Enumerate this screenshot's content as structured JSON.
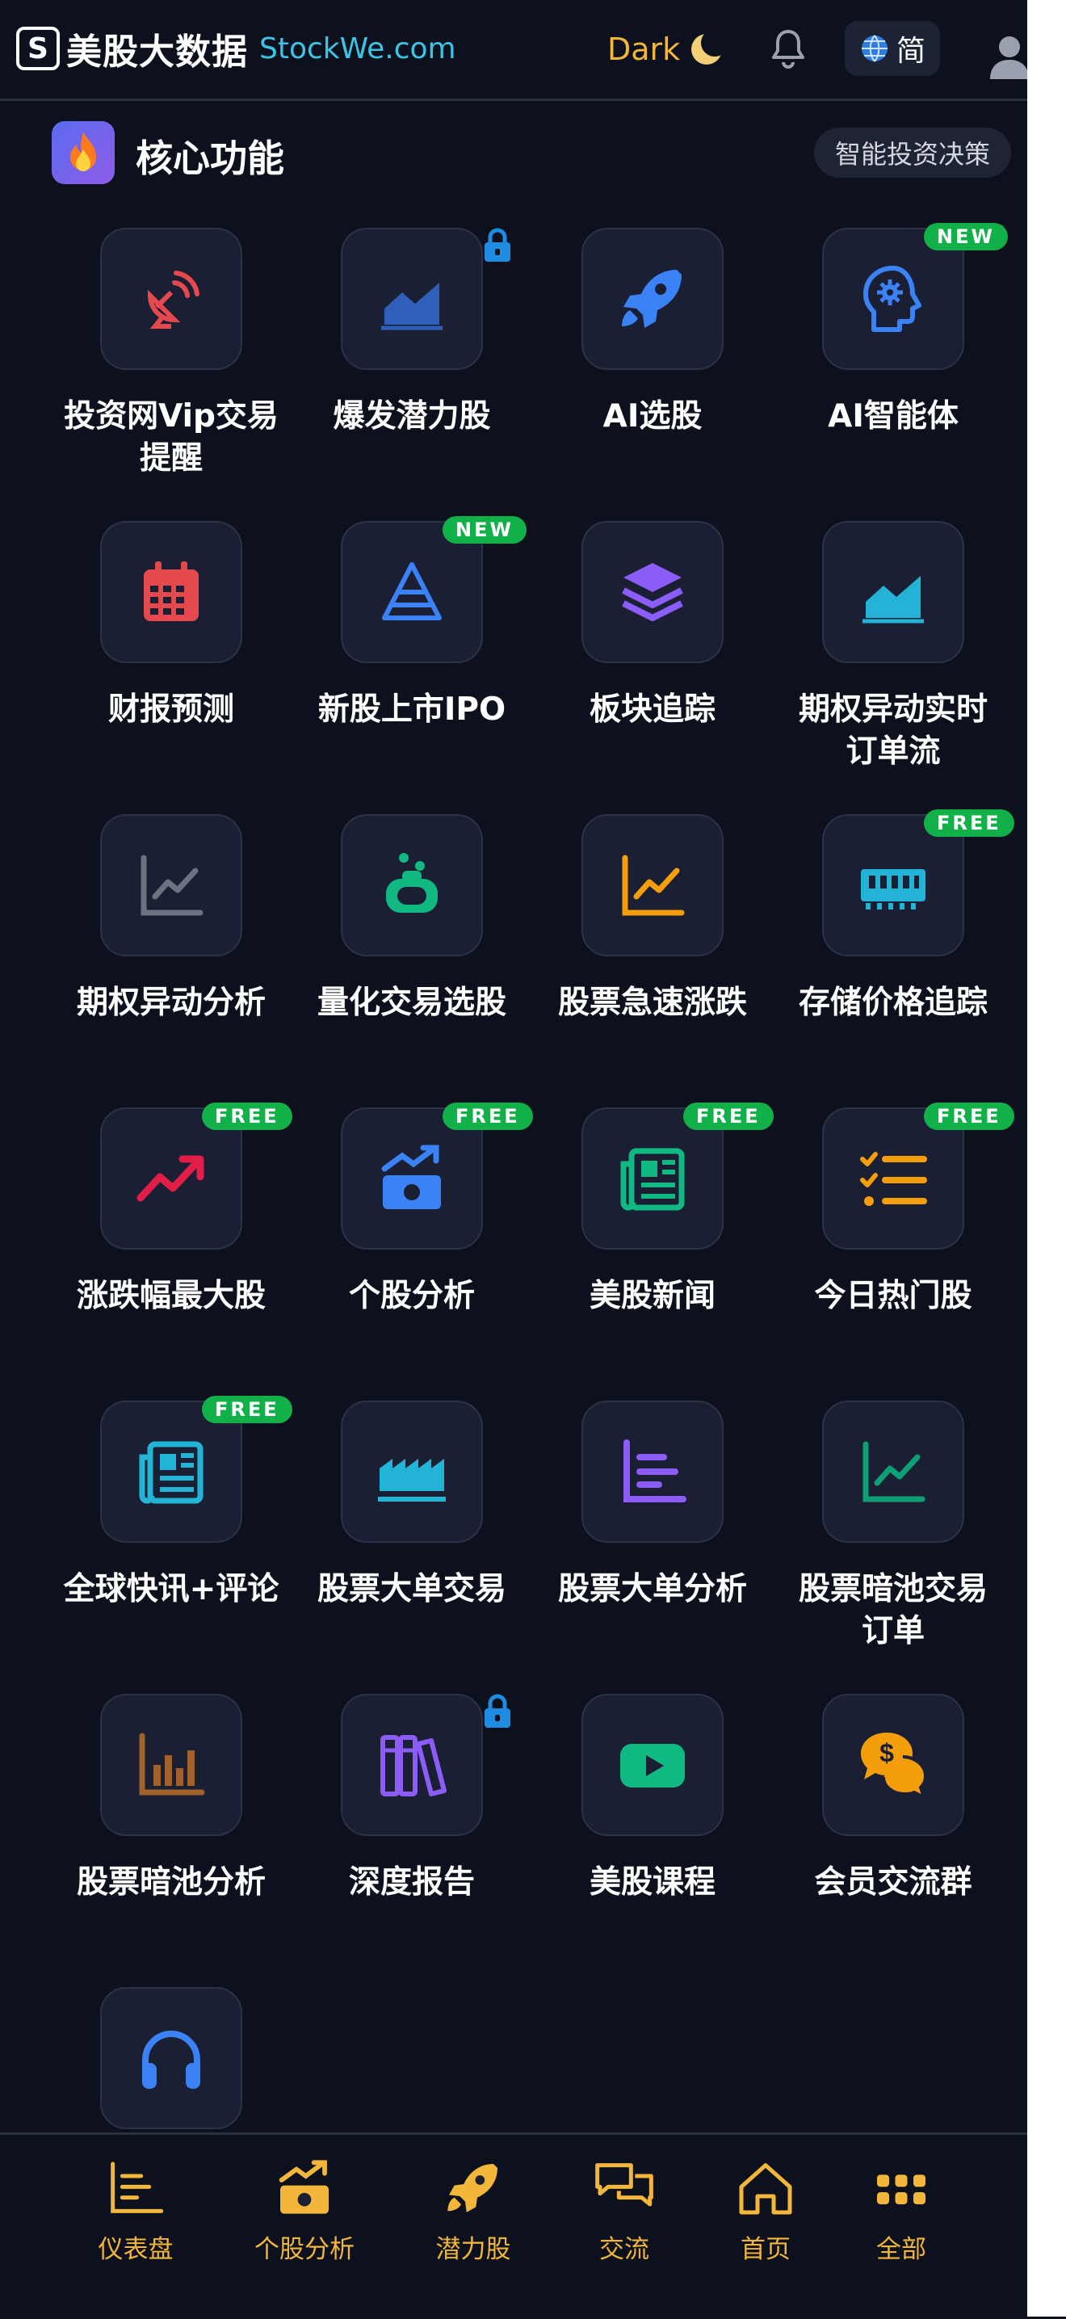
{
  "header": {
    "logo_cn": "美股大数据",
    "logo_en": "StockWe.com",
    "theme_label": "Dark",
    "language_label": "简"
  },
  "section": {
    "title": "核心功能",
    "pill": "智能投资决策"
  },
  "features": [
    {
      "label": "投资网Vip交易\n提醒",
      "icon": "satellite-dish-icon",
      "color": "#e5484d"
    },
    {
      "label": "爆发潜力股",
      "icon": "area-chart-icon",
      "color": "#2f5fb8",
      "locked": true
    },
    {
      "label": "AI选股",
      "icon": "rocket-icon",
      "color": "#3b82f6"
    },
    {
      "label": "AI智能体",
      "icon": "brain-gear-icon",
      "color": "#3b82f6",
      "badge": "NEW"
    },
    {
      "label": "财报预测",
      "icon": "calendar-icon",
      "color": "#e5484d"
    },
    {
      "label": "新股上市IPO",
      "icon": "pyramid-icon",
      "color": "#3b82f6",
      "badge": "NEW"
    },
    {
      "label": "板块追踪",
      "icon": "layers-icon",
      "color": "#8b5cf6"
    },
    {
      "label": "期权异动实时\n订单流",
      "icon": "area-chart-icon",
      "color": "#22b3d6"
    },
    {
      "label": "期权异动分析",
      "icon": "line-chart-icon",
      "color": "#6b7280"
    },
    {
      "label": "量化交易选股",
      "icon": "robot-icon",
      "color": "#10b981"
    },
    {
      "label": "股票急速涨跌",
      "icon": "line-chart-icon",
      "color": "#f59e0b"
    },
    {
      "label": "存储价格追踪",
      "icon": "memory-icon",
      "color": "#22b3d6",
      "badge": "FREE"
    },
    {
      "label": "涨跌幅最大股",
      "icon": "trend-up-icon",
      "color": "#e11d48",
      "badge": "FREE"
    },
    {
      "label": "个股分析",
      "icon": "money-trend-icon",
      "color": "#3b82f6",
      "badge": "FREE"
    },
    {
      "label": "美股新闻",
      "icon": "newspaper-icon",
      "color": "#10b981",
      "badge": "FREE"
    },
    {
      "label": "今日热门股",
      "icon": "list-check-icon",
      "color": "#f59e0b",
      "badge": "FREE"
    },
    {
      "label": "全球快讯+评论",
      "icon": "newspaper-icon",
      "color": "#22b3d6",
      "badge": "FREE"
    },
    {
      "label": "股票大单交易",
      "icon": "industry-icon",
      "color": "#22b3d6"
    },
    {
      "label": "股票大单分析",
      "icon": "bar-list-icon",
      "color": "#8b5cf6"
    },
    {
      "label": "股票暗池交易\n订单",
      "icon": "line-chart-icon",
      "color": "#0f9f74"
    },
    {
      "label": "股票暗池分析",
      "icon": "bar-chart-icon",
      "color": "#a0612a"
    },
    {
      "label": "深度报告",
      "icon": "books-icon",
      "color": "#8b5cf6",
      "locked": true
    },
    {
      "label": "美股课程",
      "icon": "youtube-icon",
      "color": "#10b981"
    },
    {
      "label": "会员交流群",
      "icon": "chat-dollar-icon",
      "color": "#f59e0b"
    },
    {
      "label": "",
      "icon": "headphones-icon",
      "color": "#3b82f6"
    }
  ],
  "nav": [
    {
      "label": "仪表盘",
      "icon": "dashboard-icon"
    },
    {
      "label": "个股分析",
      "icon": "money-trend-icon"
    },
    {
      "label": "潜力股",
      "icon": "rocket-icon"
    },
    {
      "label": "交流",
      "icon": "chat-icon"
    },
    {
      "label": "首页",
      "icon": "home-icon"
    },
    {
      "label": "全部",
      "icon": "grid-icon"
    }
  ],
  "colors": {
    "background": "#0d111d",
    "tile": "#1b1f33",
    "accent": "#f2b63a",
    "badge_green": "#12b048"
  }
}
